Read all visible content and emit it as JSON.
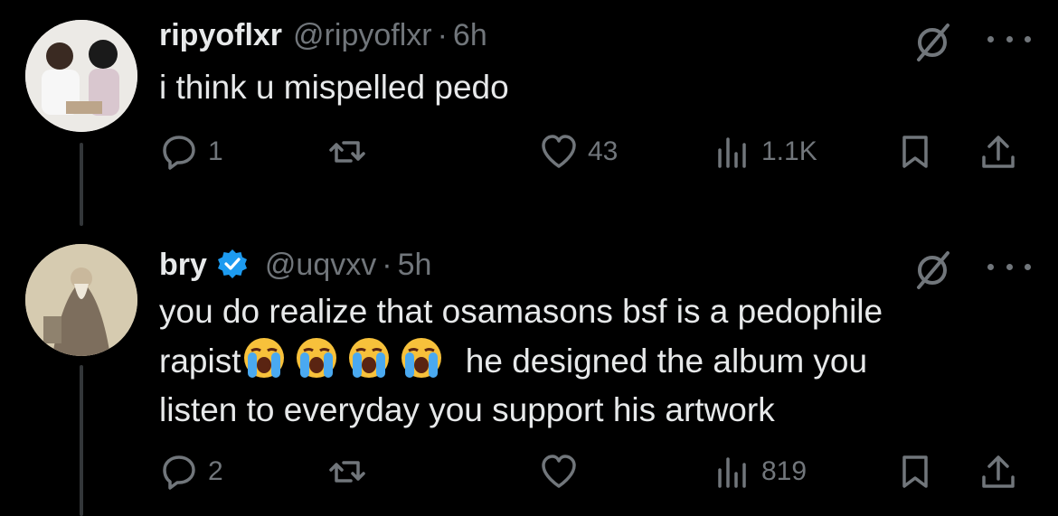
{
  "tweets": [
    {
      "name": "ripyoflxr",
      "handle": "@ripyoflxr",
      "separator": "·",
      "time": "6h",
      "verified": false,
      "text": "i think u mispelled pedo",
      "actions": {
        "replies": "1",
        "reposts": "",
        "likes": "43",
        "views": "1.1K"
      }
    },
    {
      "name": "bry",
      "handle": "@uqvxv",
      "separator": "·",
      "time": "5h",
      "verified": true,
      "text_line1": "you do realize that osamasons bsf is a pedophile",
      "text_line2_start": "rapist",
      "text_line2_end": "he designed the album you",
      "text_line3": "listen to everyday you support his artwork",
      "emoji": "loudly-crying-face",
      "actions": {
        "replies": "2",
        "reposts": "",
        "likes": "",
        "views": "819"
      }
    }
  ],
  "colors": {
    "background": "#000000",
    "text": "#e7e9ea",
    "muted": "#71767b",
    "verified": "#1d9bf0"
  }
}
